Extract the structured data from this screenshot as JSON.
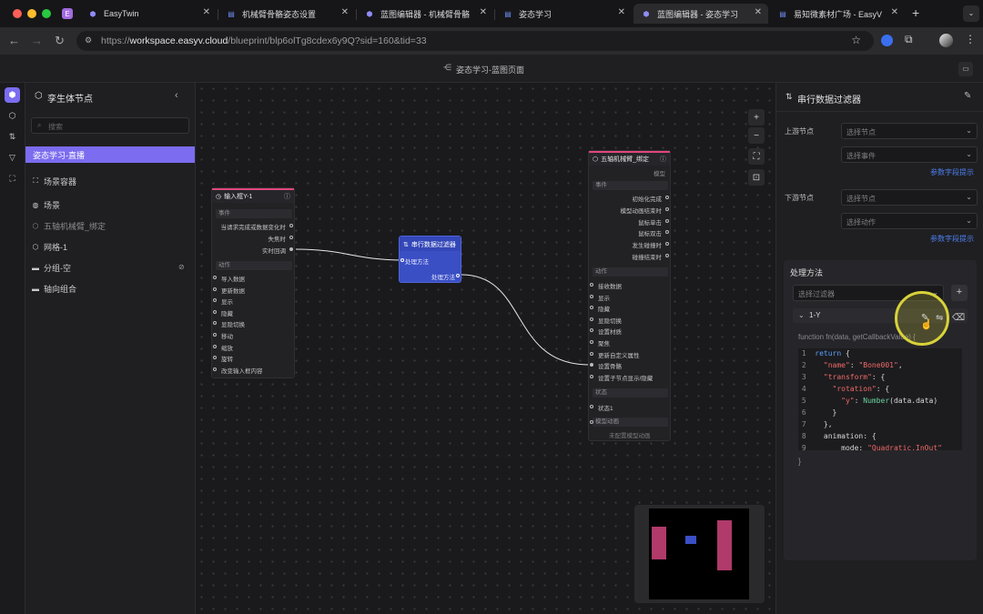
{
  "browser": {
    "tabs": [
      {
        "label": "EasyTwin",
        "icon": "easytwin-icon",
        "active": false
      },
      {
        "label": "机械臂骨骼姿态设置",
        "icon": "doc-icon",
        "active": false
      },
      {
        "label": "蓝图编辑器 - 机械臂骨骼",
        "icon": "cube-icon",
        "active": false
      },
      {
        "label": "姿态学习",
        "icon": "doc-icon",
        "active": false
      },
      {
        "label": "蓝图编辑器 - 姿态学习",
        "icon": "cube-icon",
        "active": true
      },
      {
        "label": "易知微素材广场 - EasyV",
        "icon": "doc-icon",
        "active": false
      }
    ],
    "new_tab": "+",
    "url_prefix": "https://",
    "url_host": "workspace.easyv.cloud",
    "url_path": "/blueprint/blp6olTg8cdex6y9Q?sid=160&tid=33"
  },
  "app": {
    "title": "姿态学习-蓝图页面"
  },
  "left_panel": {
    "title": "孪生体节点",
    "search_placeholder": "搜索",
    "items": [
      {
        "label": "姿态学习-直播",
        "icon": "",
        "selected": true
      },
      {
        "label": "场景容器",
        "icon": "frame-icon"
      },
      {
        "label": "场景",
        "icon": "globe-icon"
      },
      {
        "label": "五轴机械臂_绑定",
        "icon": "cube-icon",
        "dim": true
      },
      {
        "label": "网格-1",
        "icon": "cube-icon"
      },
      {
        "label": "分组-空",
        "icon": "folder-icon"
      },
      {
        "label": "轴向组合",
        "icon": "folder-icon"
      }
    ]
  },
  "nodes": {
    "input": {
      "title": "输入框Y-1",
      "section_events": "事件",
      "events": [
        "当请求完成或数据变化时",
        "失焦时",
        "实时回调"
      ],
      "section_actions": "动作",
      "actions": [
        "导入数据",
        "更新数据",
        "显示",
        "隐藏",
        "显隐切换",
        "移动",
        "缩放",
        "旋转",
        "改变输入框内容"
      ]
    },
    "filter": {
      "title": "串行数据过滤器",
      "in_label": "处理方法",
      "out_label": "处理方法"
    },
    "arm": {
      "title": "五轴机械臂_绑定",
      "subtitle": "模型",
      "section_events": "事件",
      "events": [
        "初始化完成",
        "模型动画结束时",
        "鼠标单击",
        "鼠标双击",
        "发生碰撞时",
        "碰撞结束时"
      ],
      "section_actions": "动作",
      "actions": [
        "接收数据",
        "显示",
        "隐藏",
        "显隐切换",
        "设置材质",
        "聚焦",
        "更新自定义属性",
        "设置骨骼",
        "设置子节点显示/隐藏"
      ],
      "section_state": "状态",
      "states": [
        "状态1"
      ],
      "section_anim": "模型动画",
      "anim_empty": "未配置模型动画"
    }
  },
  "right_panel": {
    "title": "串行数据过滤器",
    "upstream_label": "上游节点",
    "upstream_node_placeholder": "选择节点",
    "upstream_event_placeholder": "选择事件",
    "param_hint_1": "参数字段提示",
    "downstream_label": "下游节点",
    "downstream_node_placeholder": "选择节点",
    "downstream_action_placeholder": "选择动作",
    "param_hint_2": "参数字段提示",
    "method_title": "处理方法",
    "filter_placeholder": "选择过滤器",
    "filter_item": "1-Y",
    "fn_signature": "function fn(data, getCallbackValue) {",
    "code_lines": [
      {
        "n": "1",
        "t": "return {"
      },
      {
        "n": "2",
        "t": "\"name\": \"Bone001\","
      },
      {
        "n": "3",
        "t": "\"transform\": {"
      },
      {
        "n": "4",
        "t": "\"rotation\": {"
      },
      {
        "n": "5",
        "t": "\"y\": Number(data.data)"
      },
      {
        "n": "6",
        "t": "}"
      },
      {
        "n": "7",
        "t": "},"
      },
      {
        "n": "8",
        "t": "animation: {"
      },
      {
        "n": "9",
        "t": "mode: \"Quadratic.InOut\""
      }
    ],
    "closing_brace": "}"
  },
  "colors": {
    "accent": "#7b6cf0",
    "node_head_stripe": "#e0467c",
    "filter_node": "#3a4fc4",
    "link": "#4c7ff0",
    "minimap_block": "#b03a6a"
  }
}
